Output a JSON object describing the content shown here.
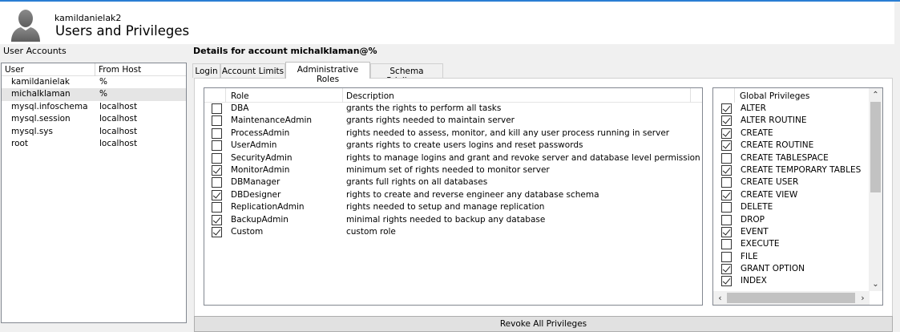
{
  "header": {
    "username": "kamildanielak2",
    "title": "Users and Privileges",
    "avatar_icon": "user-silhouette-icon"
  },
  "user_accounts": {
    "label": "User Accounts",
    "columns": [
      "User",
      "From Host"
    ],
    "rows": [
      {
        "user": "kamildanielak",
        "host": "%"
      },
      {
        "user": "michalklaman",
        "host": "%"
      },
      {
        "user": "mysql.infoschema",
        "host": "localhost"
      },
      {
        "user": "mysql.session",
        "host": "localhost"
      },
      {
        "user": "mysql.sys",
        "host": "localhost"
      },
      {
        "user": "root",
        "host": "localhost"
      }
    ],
    "selected_index": 1
  },
  "details": {
    "label": "Details for account michalklaman@%",
    "tabs": [
      "Login",
      "Account Limits",
      "Administrative Roles",
      "Schema Privileges"
    ],
    "active_tab": 2
  },
  "roles": {
    "columns": [
      "Role",
      "Description"
    ],
    "rows": [
      {
        "role": "DBA",
        "description": "grants the rights to perform all tasks",
        "checked": false
      },
      {
        "role": "MaintenanceAdmin",
        "description": "grants rights needed to maintain server",
        "checked": false
      },
      {
        "role": "ProcessAdmin",
        "description": "rights needed to assess, monitor, and kill any user process running in server",
        "checked": false
      },
      {
        "role": "UserAdmin",
        "description": "grants rights to create users logins and reset passwords",
        "checked": false
      },
      {
        "role": "SecurityAdmin",
        "description": "rights to manage logins and grant and revoke server and database level permission",
        "checked": false
      },
      {
        "role": "MonitorAdmin",
        "description": "minimum set of rights needed to monitor server",
        "checked": true
      },
      {
        "role": "DBManager",
        "description": "grants full rights on all databases",
        "checked": false
      },
      {
        "role": "DBDesigner",
        "description": "rights to create and reverse engineer any database schema",
        "checked": true
      },
      {
        "role": "ReplicationAdmin",
        "description": "rights needed to setup and manage replication",
        "checked": false
      },
      {
        "role": "BackupAdmin",
        "description": "minimal rights needed to backup any database",
        "checked": true
      },
      {
        "role": "Custom",
        "description": "custom role",
        "checked": true
      }
    ]
  },
  "global_privileges": {
    "header": "Global Privileges",
    "rows": [
      {
        "name": "ALTER",
        "checked": true
      },
      {
        "name": "ALTER ROUTINE",
        "checked": true
      },
      {
        "name": "CREATE",
        "checked": true
      },
      {
        "name": "CREATE ROUTINE",
        "checked": true
      },
      {
        "name": "CREATE TABLESPACE",
        "checked": false
      },
      {
        "name": "CREATE TEMPORARY TABLES",
        "checked": true
      },
      {
        "name": "CREATE USER",
        "checked": false
      },
      {
        "name": "CREATE VIEW",
        "checked": true
      },
      {
        "name": "DELETE",
        "checked": false
      },
      {
        "name": "DROP",
        "checked": false
      },
      {
        "name": "EVENT",
        "checked": true
      },
      {
        "name": "EXECUTE",
        "checked": false
      },
      {
        "name": "FILE",
        "checked": false
      },
      {
        "name": "GRANT OPTION",
        "checked": true
      },
      {
        "name": "INDEX",
        "checked": true
      }
    ]
  },
  "revoke_button": "Revoke All Privileges",
  "colors": {
    "accent": "#2a7ed3",
    "selection": "#e5e5e5",
    "border": "#828790"
  }
}
